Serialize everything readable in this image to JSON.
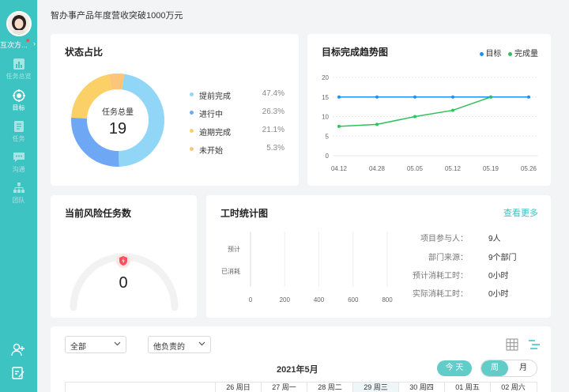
{
  "user": {
    "name": "互次方..."
  },
  "nav": [
    {
      "label": "任务总览",
      "icon": "chart-icon",
      "active": false
    },
    {
      "label": "目标",
      "icon": "target-icon",
      "active": true
    },
    {
      "label": "任务",
      "icon": "task-icon",
      "active": false
    },
    {
      "label": "沟通",
      "icon": "chat-icon",
      "active": false
    },
    {
      "label": "团队",
      "icon": "team-icon",
      "active": false
    }
  ],
  "page_title": "智办事产品年度营收突破1000万元",
  "status": {
    "title": "状态占比",
    "center_label": "任务总量",
    "center_value": "19",
    "items": [
      {
        "label": "提前完成",
        "pct": "47.4%",
        "value": 47.4,
        "color": "#91d5f7"
      },
      {
        "label": "进行中",
        "pct": "26.3%",
        "value": 26.3,
        "color": "#6ea8f5"
      },
      {
        "label": "逾期完成",
        "pct": "21.1%",
        "value": 21.1,
        "color": "#fad067"
      },
      {
        "label": "未开始",
        "pct": "5.3%",
        "value": 5.3,
        "color": "#fcc67a"
      }
    ]
  },
  "chart_data": [
    {
      "type": "line",
      "title": "目标完成趋势图",
      "x": [
        "04.12",
        "04.28",
        "05.05",
        "05.12",
        "05.19",
        "05.26"
      ],
      "ylim": [
        0,
        20
      ],
      "yticks": [
        "0",
        "5",
        "10",
        "15",
        "20"
      ],
      "series": [
        {
          "name": "目标",
          "color": "#1890ff",
          "values": [
            15,
            15,
            15,
            15,
            15,
            15
          ]
        },
        {
          "name": "完成量",
          "color": "#2fc25b",
          "values": [
            7.5,
            8,
            10,
            11.6,
            15,
            null
          ]
        }
      ],
      "legend": "top-right",
      "grid": true
    },
    {
      "type": "bar",
      "title": "工时统计图",
      "categories": [
        "预计",
        "已消耗"
      ],
      "values": [
        0,
        0
      ],
      "xticks": [
        "0",
        "200",
        "400",
        "600",
        "800"
      ],
      "xlim": [
        0,
        800
      ],
      "orientation": "horizontal"
    }
  ],
  "risk": {
    "title": "当前风险任务数",
    "value": "0",
    "gauge_fraction": 0
  },
  "worktime": {
    "see_more": "查看更多",
    "stats": [
      {
        "k": "项目参与人：",
        "v": "9人"
      },
      {
        "k": "部门来源：",
        "v": "9个部门"
      },
      {
        "k": "预计消耗工时：",
        "v": "0小时"
      },
      {
        "k": "实际消耗工时：",
        "v": "0小时"
      }
    ]
  },
  "calendar": {
    "filter1": "全部",
    "filter2": "他负责的",
    "month": "2021年5月",
    "today": "今 天",
    "week": "周",
    "monthview": "月",
    "day_headers": [
      "26 周日",
      "27 周一",
      "28 周二",
      "29 周三",
      "30 周四",
      "01 周五",
      "02 周六"
    ]
  }
}
